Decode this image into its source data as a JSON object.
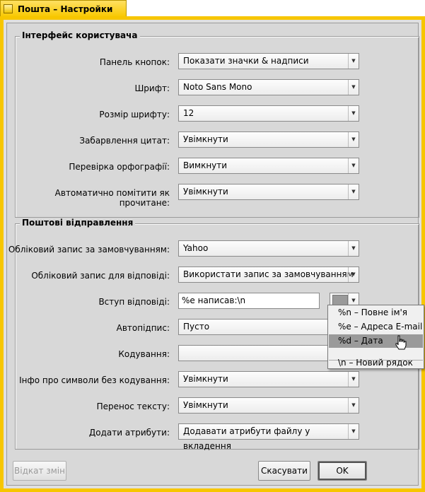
{
  "window": {
    "title": "Пошта – Настройки"
  },
  "ui_group": {
    "label": "Інтерфейс користувача",
    "rows": [
      {
        "label": "Панель кнопок:",
        "value": "Показати значки & надписи"
      },
      {
        "label": "Шрифт:",
        "value": "Noto Sans Mono"
      },
      {
        "label": "Розмір шрифту:",
        "value": "12"
      },
      {
        "label": "Забарвлення цитат:",
        "value": "Увімкнути"
      },
      {
        "label": "Перевірка орфографії:",
        "value": "Вимкнути"
      },
      {
        "label": "Автоматично помітити як прочитане:",
        "value": "Увімкнути"
      }
    ]
  },
  "send_group": {
    "label": "Поштові відправлення",
    "default_account": {
      "label": "Обліковий запис за замовчуванням:",
      "value": "Yahoo"
    },
    "reply_account": {
      "label": "Обліковий запис для відповіді:",
      "value": "Використати запис за замовчуванням"
    },
    "reply_preamble": {
      "label": "Вступ відповіді:",
      "value": "%e написав:\\n"
    },
    "autosignature": {
      "label": "Автопідпис:",
      "value": "Пусто"
    },
    "encoding": {
      "label": "Кодування:",
      "value": ""
    },
    "unencodable_info": {
      "label": "Інфо про символи без кодування:",
      "value": "Увімкнути"
    },
    "word_wrap": {
      "label": "Перенос тексту:",
      "value": "Увімкнути"
    },
    "attributes": {
      "label": "Додати атрибути:",
      "value": "Додавати атрибути файлу у вкладення"
    }
  },
  "preamble_menu": {
    "items": [
      {
        "label": "%n – Повне ім'я"
      },
      {
        "label": "%e – Адреса E-mail"
      },
      {
        "label": "%d – Дата"
      },
      {
        "label": "\\n – Новий рядок"
      }
    ]
  },
  "buttons": {
    "revert": "Відкат змін",
    "cancel": "Скасувати",
    "ok": "OK"
  },
  "colors": {
    "tab_yellow": "#f8c800",
    "window_bg": "#d8d8d8",
    "menu_highlight": "#9a9a9a"
  }
}
